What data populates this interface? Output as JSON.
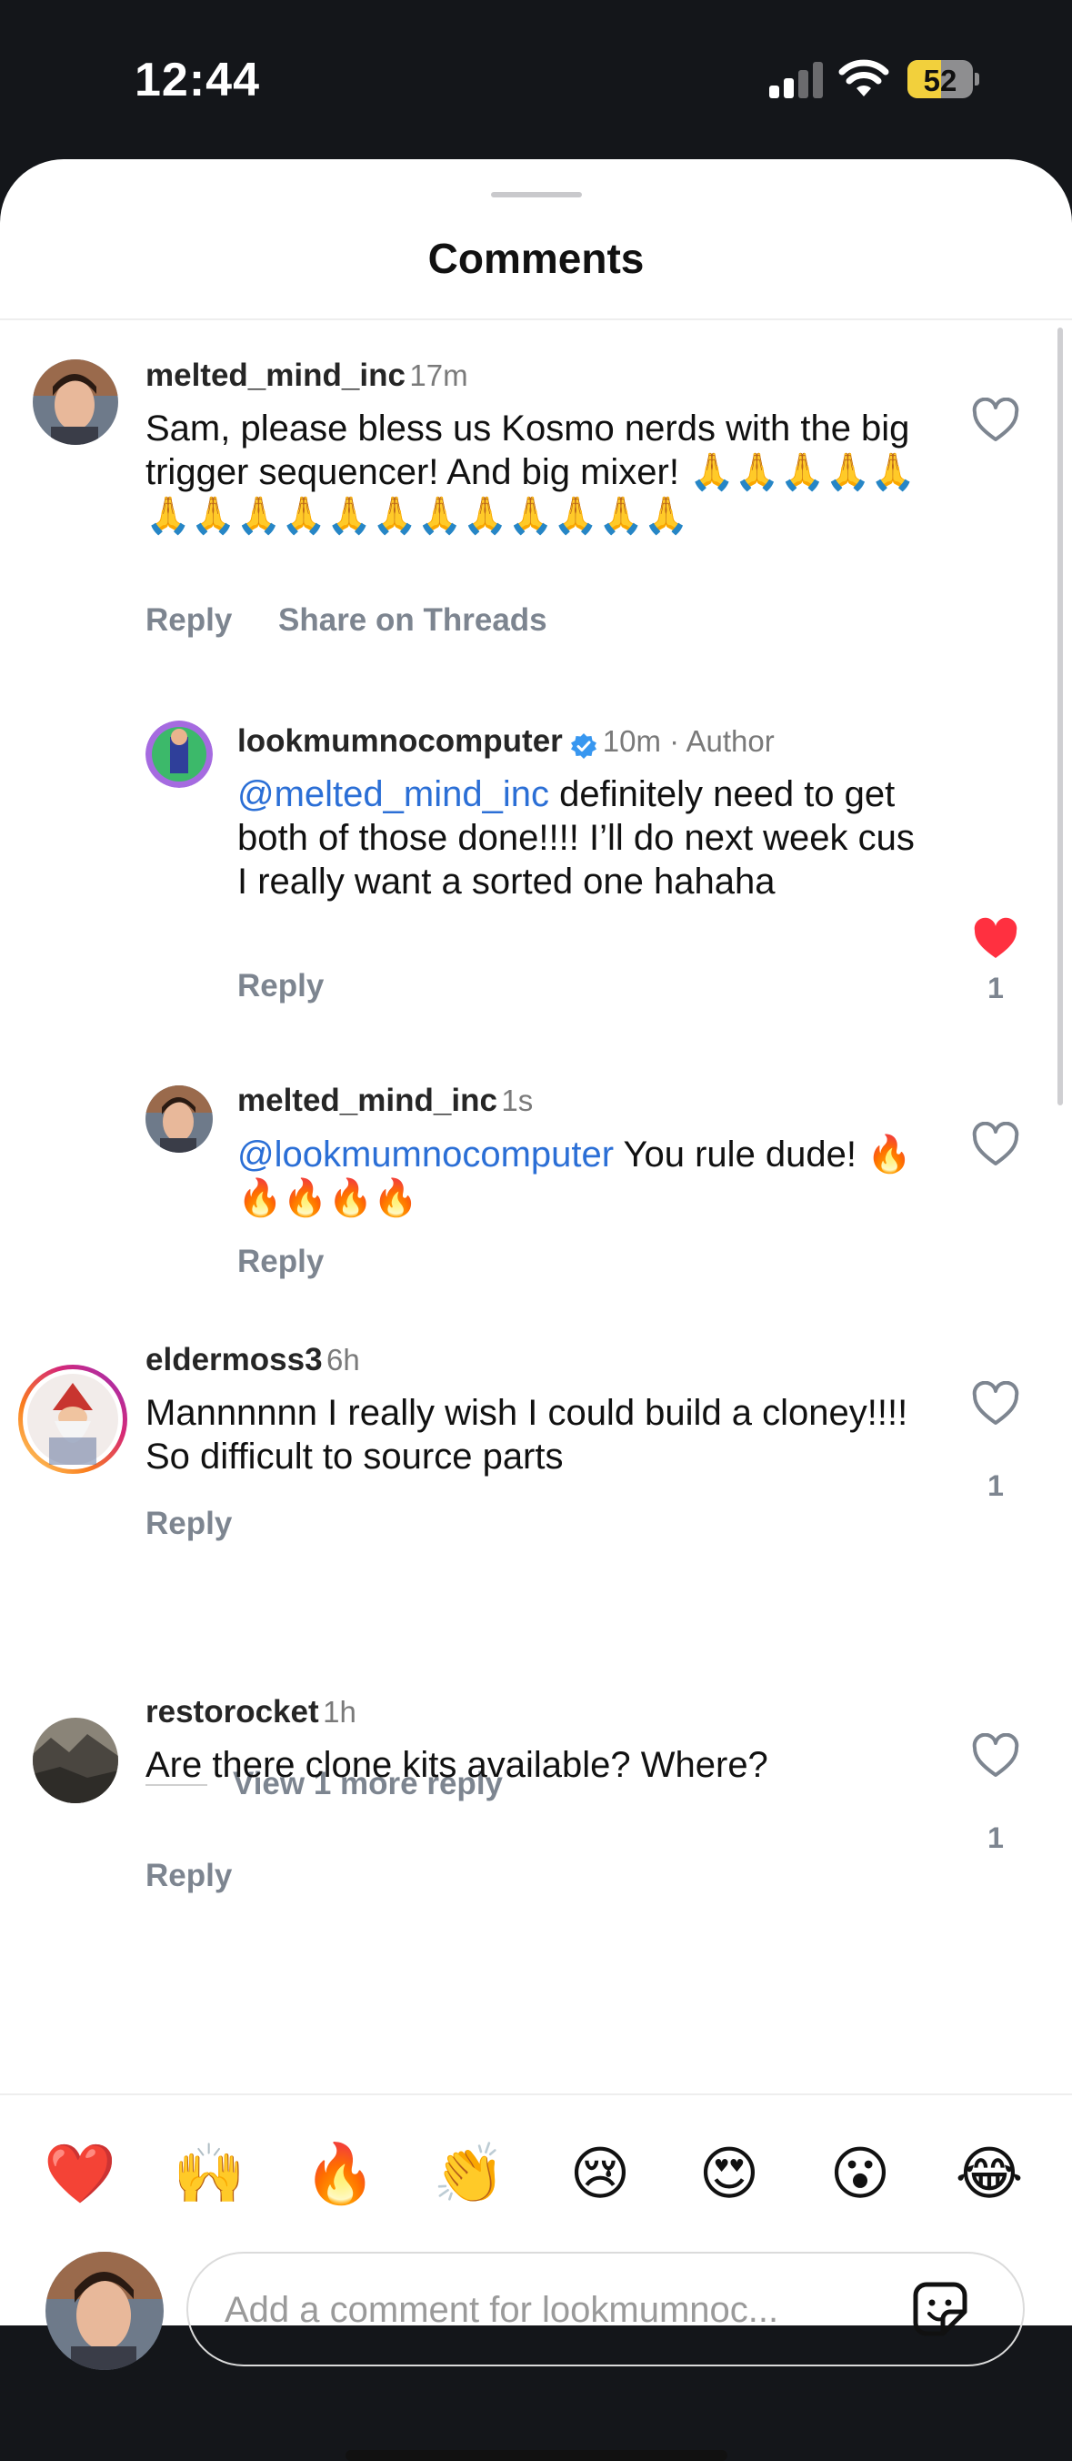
{
  "status_bar": {
    "time": "12:44",
    "battery": "52"
  },
  "sheet": {
    "title": "Comments"
  },
  "comments": [
    {
      "username": "melted_mind_inc",
      "time": "17m",
      "text": "Sam, please bless us Kosmo nerds with the big trigger sequencer! And big mixer! 🙏🙏🙏🙏🙏🙏🙏🙏🙏🙏🙏🙏🙏🙏🙏🙏🙏",
      "reply_label": "Reply",
      "share_label": "Share on Threads",
      "liked": false
    },
    {
      "username": "lookmumnocomputer",
      "time": "10m · Author",
      "mention": "@melted_mind_inc",
      "text": " definitely need to get both of those done!!!! I’ll do next week cus I really want a sorted one hahaha",
      "reply_label": "Reply",
      "liked": true,
      "likes": "1"
    },
    {
      "username": "melted_mind_inc",
      "time": "1s",
      "mention": "@lookmumnocomputer",
      "text": " You rule dude! 🔥🔥🔥🔥🔥",
      "reply_label": "Reply",
      "liked": false
    },
    {
      "username": "eldermoss3",
      "time": "6h",
      "text": "Mannnnnn I really wish I could build a cloney!!!! So difficult to source parts",
      "reply_label": "Reply",
      "liked": false,
      "likes": "1",
      "view_more": "View 1 more reply"
    },
    {
      "username": "restorocket",
      "time": "1h",
      "text": "Are there clone kits available? Where?",
      "reply_label": "Reply",
      "liked": false,
      "likes": "1"
    }
  ],
  "quick_reactions": [
    "❤️",
    "🙌",
    "🔥",
    "👏",
    "😢",
    "😍",
    "😮",
    "😂"
  ],
  "composer": {
    "placeholder": "Add a comment for lookmumnoc..."
  },
  "icons": [
    "heart-outline-icon",
    "heart-filled-icon",
    "verified-badge-icon",
    "sticker-icon",
    "signal-icon",
    "wifi-icon",
    "battery-icon"
  ],
  "colors": {
    "mention": "#2b6fd6",
    "like_active": "#ff3040",
    "battery_fill": "#f2d03c",
    "story_ring": "#e1306c"
  }
}
